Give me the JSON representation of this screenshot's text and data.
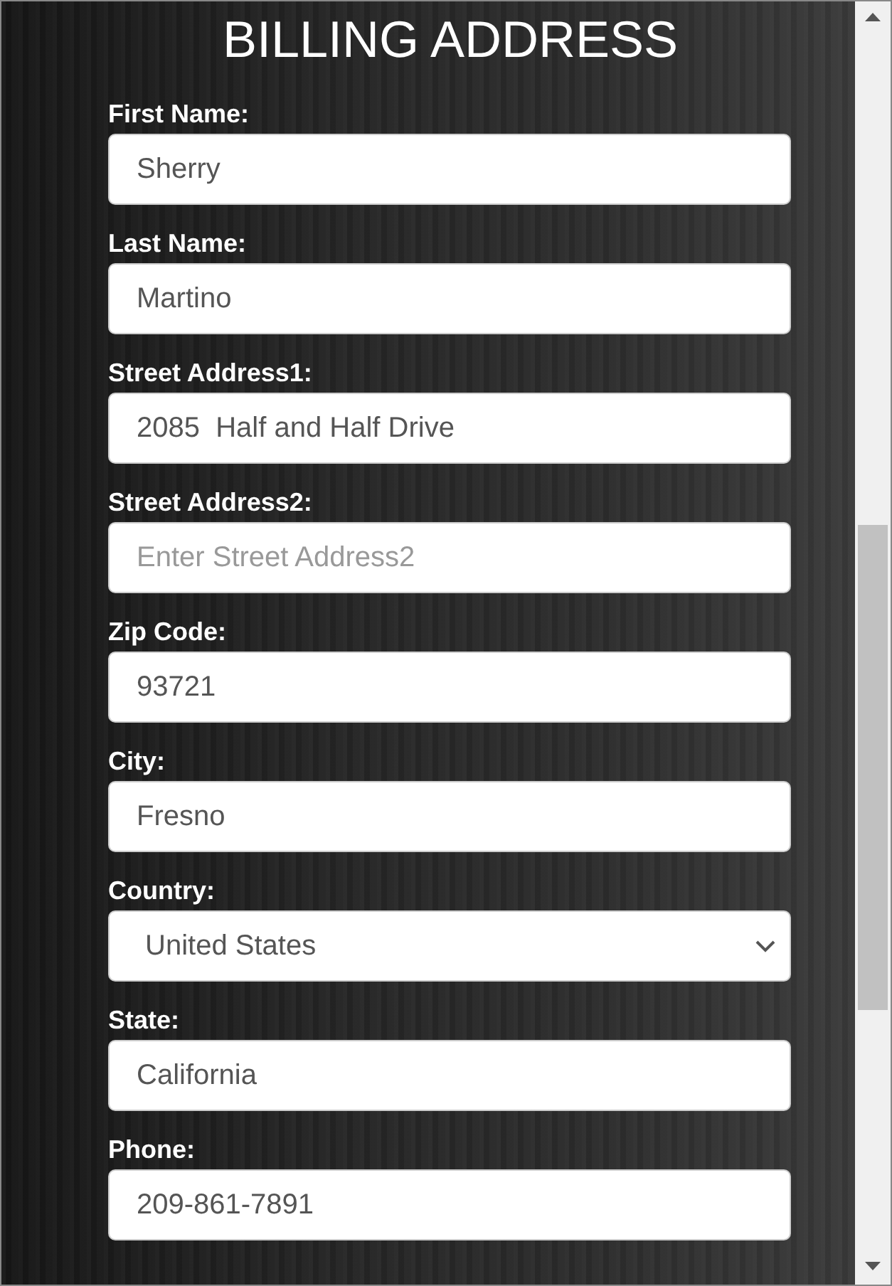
{
  "title": "BILLING ADDRESS",
  "fields": [
    {
      "kind": "text",
      "label": "First Name:",
      "value": "Sherry"
    },
    {
      "kind": "text",
      "label": "Last Name:",
      "value": "Martino"
    },
    {
      "kind": "text",
      "label": "Street Address1:",
      "value": "2085  Half and Half Drive"
    },
    {
      "kind": "text",
      "label": "Street Address2:",
      "placeholder": "Enter Street Address2"
    },
    {
      "kind": "text",
      "label": "Zip Code:",
      "value": "93721"
    },
    {
      "kind": "text",
      "label": "City:",
      "value": "Fresno"
    },
    {
      "kind": "select",
      "label": "Country:",
      "value": "United States"
    },
    {
      "kind": "text",
      "label": "State:",
      "value": "California"
    },
    {
      "kind": "text",
      "label": "Phone:",
      "value": "209-861-7891"
    }
  ]
}
